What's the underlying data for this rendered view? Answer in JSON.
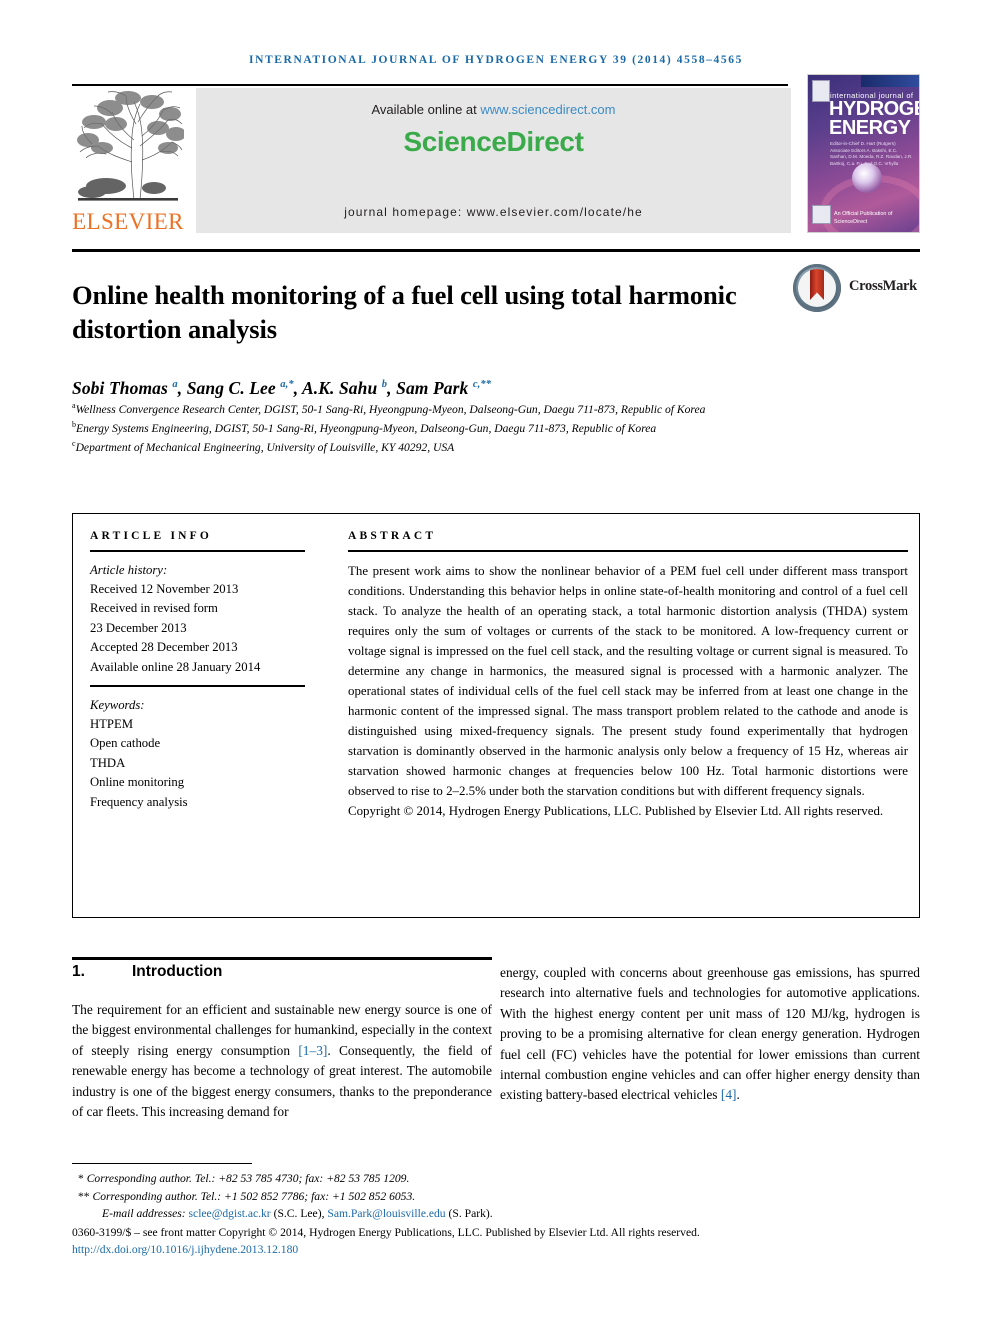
{
  "running_head": "INTERNATIONAL JOURNAL OF HYDROGEN ENERGY 39 (2014) 4558–4565",
  "masthead": {
    "publisher_name": "ELSEVIER",
    "available_prefix": "Available online at ",
    "available_url": "www.sciencedirect.com",
    "sciencedirect_science": "Science",
    "sciencedirect_direct": "Direct",
    "journal_homepage": "journal homepage: www.elsevier.com/locate/he",
    "cover": {
      "line_top": "international journal of",
      "title_line1": "HYDROGEN",
      "title_line2": "ENERGY",
      "editors": "Editor-in-Chief  D. Hart (Rutgers)   Associate Editors  A. Bakshi, E.C. Sanhan, D.M. Moeda, R.Z. Ravdan, J.R. Bartkoj, C.a. Fu, Fod O.C. Vrhylla",
      "footer": "An Official Publication of  ScienceDirect"
    }
  },
  "title": "Online health monitoring of a fuel cell using total harmonic distortion analysis",
  "crossmark_label": "CrossMark",
  "authors_html": "Sobi Thomas <sup>a</sup>, Sang C. Lee <sup>a,*</sup>, A.K. Sahu <sup>b</sup>, Sam Park <sup>c,**</sup>",
  "affiliations": [
    {
      "marker": "a",
      "text": "Wellness Convergence Research Center, DGIST, 50-1 Sang-Ri, Hyeongpung-Myeon, Dalseong-Gun, Daegu 711-873, Republic of Korea"
    },
    {
      "marker": "b",
      "text": "Energy Systems Engineering, DGIST, 50-1 Sang-Ri, Hyeongpung-Myeon, Dalseong-Gun, Daegu 711-873, Republic of Korea"
    },
    {
      "marker": "c",
      "text": "Department of Mechanical Engineering, University of Louisville, KY 40292, USA"
    }
  ],
  "article_info": {
    "heading": "ARTICLE INFO",
    "history_label": "Article history:",
    "history": [
      "Received 12 November 2013",
      "Received in revised form",
      "23 December 2013",
      "Accepted 28 December 2013",
      "Available online 28 January 2014"
    ],
    "keywords_label": "Keywords:",
    "keywords": [
      "HTPEM",
      "Open cathode",
      "THDA",
      "Online monitoring",
      "Frequency analysis"
    ]
  },
  "abstract": {
    "heading": "ABSTRACT",
    "body": "The present work aims to show the nonlinear behavior of a PEM fuel cell under different mass transport conditions. Understanding this behavior helps in online state-of-health monitoring and control of a fuel cell stack. To analyze the health of an operating stack, a total harmonic distortion analysis (THDA) system requires only the sum of voltages or currents of the stack to be monitored. A low-frequency current or voltage signal is impressed on the fuel cell stack, and the resulting voltage or current signal is measured. To determine any change in harmonics, the measured signal is processed with a harmonic analyzer. The operational states of individual cells of the fuel cell stack may be inferred from at least one change in the harmonic content of the impressed signal. The mass transport problem related to the cathode and anode is distinguished using mixed-frequency signals. The present study found experimentally that hydrogen starvation is dominantly observed in the harmonic analysis only below a frequency of 15 Hz, whereas air starvation showed harmonic changes at frequencies below 100 Hz. Total harmonic distortions were observed to rise to 2–2.5% under both the starvation conditions but with different frequency signals.",
    "copyright": "Copyright © 2014, Hydrogen Energy Publications, LLC. Published by Elsevier Ltd. All rights reserved."
  },
  "section": {
    "number": "1.",
    "title": "Introduction"
  },
  "body": {
    "left_part1": "The requirement for an efficient and sustainable new energy source is one of the biggest environmental challenges for humankind, especially in the context of steeply rising energy consumption ",
    "left_ref1": "[1–3]",
    "left_part2": ". Consequently, the field of renewable energy has become a technology of great interest. The automobile industry is one of the biggest energy consumers, thanks to the preponderance of car fleets. This increasing demand for",
    "right_part1": "energy, coupled with concerns about greenhouse gas emissions, has spurred research into alternative fuels and technologies for automotive applications. With the highest energy content per unit mass of 120 MJ/kg, hydrogen is proving to be a promising alternative for clean energy generation. Hydrogen fuel cell (FC) vehicles have the potential for lower emissions than current internal combustion engine vehicles and can offer higher energy density than existing battery-based electrical vehicles ",
    "right_ref1": "[4]",
    "right_part2": "."
  },
  "footnotes": {
    "corr1_star": "*",
    "corr1": "Corresponding author. Tel.: +82 53 785 4730; fax: +82 53 785 1209.",
    "corr2_star": "**",
    "corr2": "Corresponding author. Tel.: +1 502 852 7786; fax: +1 502 852 6053.",
    "email_label": "E-mail addresses:",
    "email1": "sclee@dgist.ac.kr",
    "email1_owner": "(S.C. Lee),",
    "email2": "Sam.Park@louisville.edu",
    "email2_owner": "(S. Park).",
    "issn_line": "0360-3199/$ – see front matter Copyright © 2014, Hydrogen Energy Publications, LLC. Published by Elsevier Ltd. All rights reserved.",
    "doi": "http://dx.doi.org/10.1016/j.ijhydene.2013.12.180"
  },
  "colors": {
    "link_blue": "#1a6aa8",
    "sciencedirect_green": "#3aaa4a",
    "elsevier_orange": "#ea7125",
    "sd_band_gray": "#e6e6e6"
  }
}
